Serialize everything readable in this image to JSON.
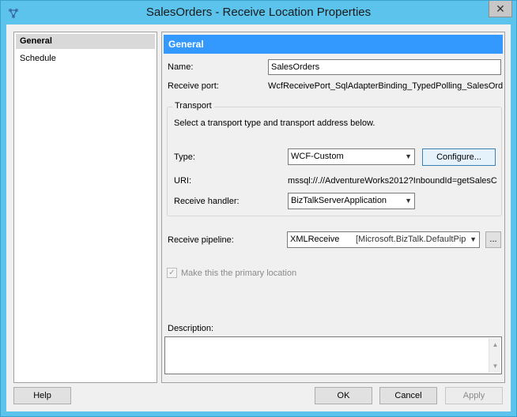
{
  "window": {
    "title": "SalesOrders - Receive Location Properties",
    "close_glyph": "✕"
  },
  "nav": {
    "items": [
      {
        "label": "General",
        "selected": true
      },
      {
        "label": "Schedule",
        "selected": false
      }
    ]
  },
  "general": {
    "header": "General",
    "name_label": "Name:",
    "name_value": "SalesOrders",
    "receive_port_label": "Receive port:",
    "receive_port_value": "WcfReceivePort_SqlAdapterBinding_TypedPolling_SalesOrder",
    "transport": {
      "group_title": "Transport",
      "instructions": "Select a transport type and transport address below.",
      "type_label": "Type:",
      "type_value": "WCF-Custom",
      "configure_button": "Configure...",
      "uri_label": "URI:",
      "uri_value": "mssql://.//AdventureWorks2012?InboundId=getSalesC",
      "handler_label": "Receive handler:",
      "handler_value": "BizTalkServerApplication"
    },
    "pipeline_label": "Receive pipeline:",
    "pipeline_name": "XMLReceive",
    "pipeline_assembly": "[Microsoft.BizTalk.DefaultPip",
    "pipeline_browse": "...",
    "primary_location_label": "Make this the primary location",
    "primary_location_checked": true,
    "description_label": "Description:",
    "description_value": ""
  },
  "footer": {
    "help": "Help",
    "ok": "OK",
    "cancel": "Cancel",
    "apply": "Apply"
  }
}
